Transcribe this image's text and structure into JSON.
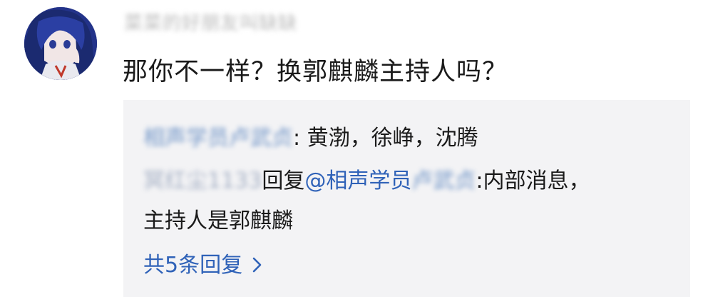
{
  "comment": {
    "username": "菜菜的好朋友叫缺缺",
    "text": "那你不一样？换郭麒麟主持人吗？"
  },
  "replies": [
    {
      "author": "相声学员卢武贞",
      "separator": ":",
      "text": " 黄渤，徐峥，沈腾"
    },
    {
      "author": "冥红尘1133",
      "reply_label": "回复",
      "mention": "@相声学员",
      "mention_blurred": "卢武贞",
      "separator": ":",
      "text": "内部消息，",
      "text_line2": "主持人是郭麒麟"
    }
  ],
  "more_replies": {
    "label": "共5条回复",
    "icon": "chevron-right-icon"
  },
  "colors": {
    "link": "#2f62b8",
    "reply_bg": "#f3f3f5",
    "text": "#1a1a1a"
  }
}
